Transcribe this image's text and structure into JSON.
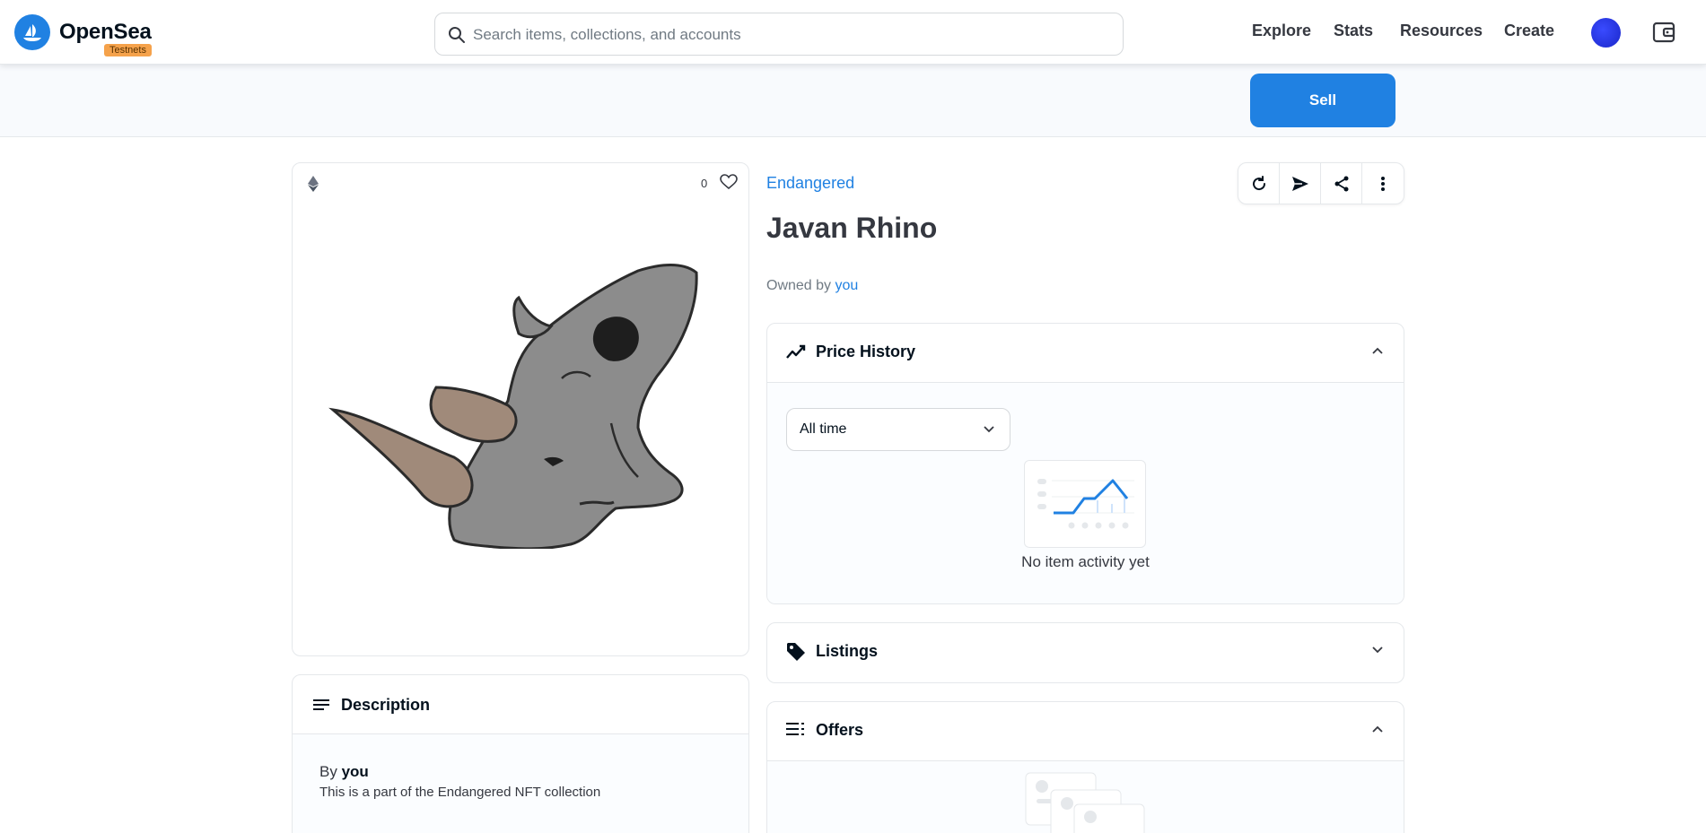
{
  "header": {
    "brand": "OpenSea",
    "badge": "Testnets",
    "search_placeholder": "Search items, collections, and accounts",
    "nav": [
      "Explore",
      "Stats",
      "Resources",
      "Create"
    ]
  },
  "subbar": {
    "sell_label": "Sell"
  },
  "item": {
    "favorites": "0",
    "collection": "Endangered",
    "title": "Javan Rhino",
    "owned_prefix": "Owned by",
    "owner": "you"
  },
  "description": {
    "title": "Description",
    "by_prefix": "By",
    "by_name": "you",
    "text": "This is a part of the Endangered NFT collection"
  },
  "price_history": {
    "title": "Price History",
    "range": "All time",
    "empty": "No item activity yet"
  },
  "listings": {
    "title": "Listings"
  },
  "offers": {
    "title": "Offers"
  },
  "colors": {
    "accent": "#2081e2",
    "badge": "#f5a24b",
    "text": "#04111d",
    "muted": "#707a83"
  }
}
